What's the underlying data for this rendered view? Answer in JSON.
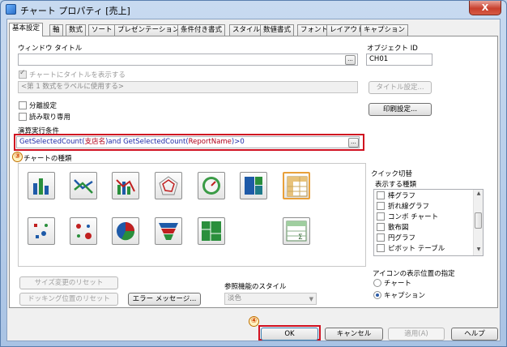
{
  "window": {
    "title": "チャート プロパティ [売上]",
    "close_label": "X"
  },
  "tabs": [
    "基本設定",
    "軸",
    "数式",
    "ソート",
    "プレゼンテーション",
    "条件付き書式",
    "スタイル",
    "数値書式",
    "フォント",
    "レイアウト",
    "キャプション"
  ],
  "general": {
    "window_title_label": "ウィンドウ タイトル",
    "window_title_value": "",
    "object_id_label": "オブジェクト ID",
    "object_id_value": "CH01",
    "show_title_label": "チャートにタイトルを表示する",
    "title_placeholder": "<第 1 数式をラベルに使用する>",
    "title_settings_button": "タイトル設定...",
    "detached_label": "分離設定",
    "readonly_label": "読み取り専用",
    "print_settings_button": "印刷設定...",
    "calc_condition_label": "演算実行条件",
    "calc_condition_parts": [
      "GetSelectedCount(",
      "支店名",
      ")and GetSelectedCount(",
      "ReportName",
      ")>0"
    ],
    "dots_label": "..."
  },
  "chart_types": {
    "label": "チャートの種類",
    "icons": [
      "bar-chart-icon",
      "combo-chart-icon",
      "line-bar-chart-icon",
      "radar-chart-icon",
      "gauge-chart-icon",
      "block-chart-icon",
      "pivot-table-icon",
      "scatter-chart-icon",
      "grid-chart-icon",
      "pie-chart-icon",
      "funnel-chart-icon",
      "mekko-chart-icon",
      "straight-table-icon"
    ]
  },
  "quick_change": {
    "label": "クイック切替",
    "list_label": "表示する種類",
    "items": [
      "棒グラフ",
      "折れ線グラフ",
      "コンボ チャート",
      "散布図",
      "円グラフ",
      "ピボット テーブル"
    ],
    "icon_position_label": "アイコンの表示位置の指定",
    "radio_chart": "チャート",
    "radio_caption": "キャプション"
  },
  "bottom": {
    "reset_size_button": "サイズ変更のリセット",
    "reset_docking_button": "ドッキング位置のリセット",
    "error_message_button": "エラー メッセージ...",
    "reference_style_label": "参照機能のスタイル",
    "reference_style_value": "淡色"
  },
  "footer": {
    "ok": "OK",
    "cancel": "キャンセル",
    "apply": "適用(A)",
    "help": "ヘルプ"
  },
  "markers": {
    "m3": "③",
    "m4": "④"
  },
  "colors": {
    "highlight_red": "#d01020",
    "formula_blue": "#1f2aa8",
    "formula_red": "#b2001a"
  }
}
